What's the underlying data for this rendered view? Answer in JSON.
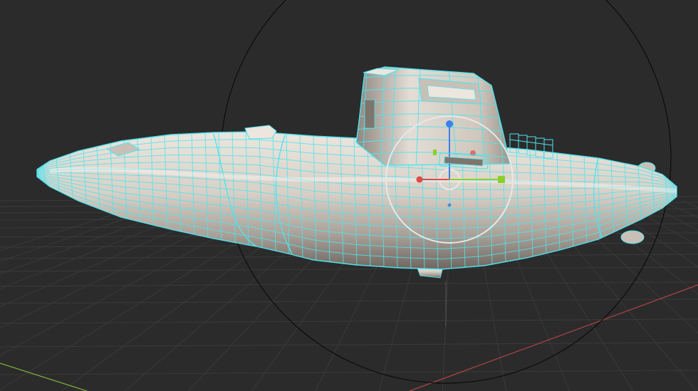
{
  "viewport": {
    "background": "#2b2b2b",
    "grid_color": "#3a3a3a",
    "x_axis_color": "#b24444",
    "y_axis_color": "#7fb03a"
  },
  "model": {
    "wire_color": "#4fe3ee",
    "surface_light": "#ece6de",
    "surface_mid": "#c8c0b6",
    "surface_dark": "#7e766e"
  },
  "gizmo": {
    "x_color": "#e04848",
    "y_color": "#8ccf2a",
    "z_color": "#3d7ee8",
    "ring_color": "#e8e8e8",
    "icons": [
      "move-gizmo",
      "rotate-ring",
      "view-sphere-outline"
    ]
  }
}
